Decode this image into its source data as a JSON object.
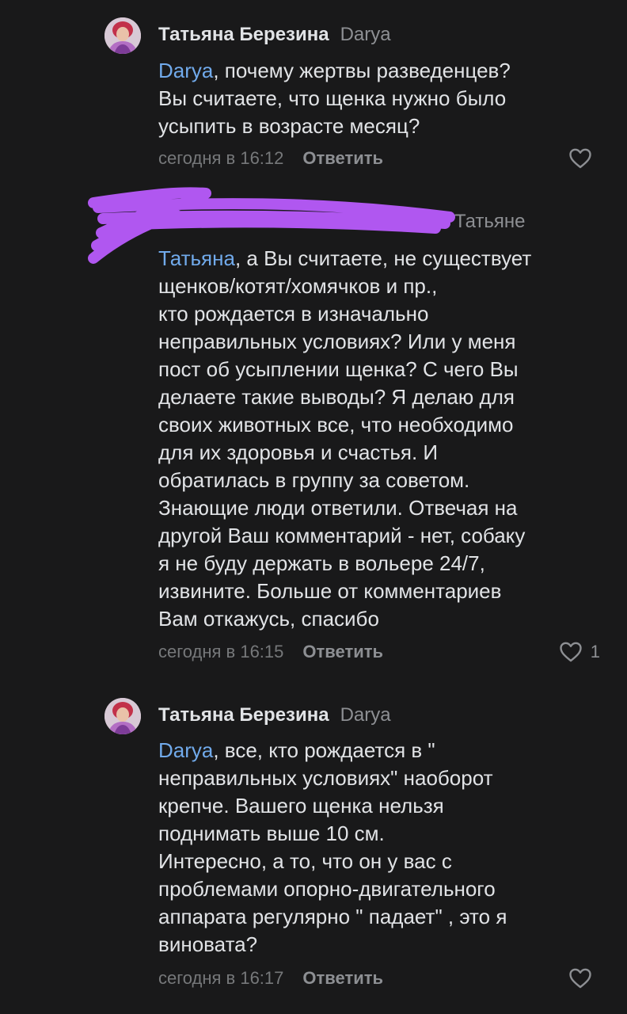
{
  "comments": [
    {
      "author": "Татьяна Березина",
      "reply_to": "Darya",
      "mention": "Darya",
      "text_lines": [
        ", почему жертвы разведенцев?",
        "Вы считаете, что щенка нужно было",
        "усыпить в возрасте месяц?"
      ],
      "time": "сегодня в 16:12",
      "reply_label": "Ответить",
      "likes": "",
      "avatar_icon": "user-photo"
    },
    {
      "author": "",
      "reply_to": "Татьяне",
      "mention": "Татьяна",
      "text_lines": [
        ", а Вы считаете, не существует",
        "щенков/котят/хомячков и пр.,",
        "кто рождается в изначально",
        "неправильных условиях? Или у меня",
        "пост об усыплении щенка? С чего Вы",
        "делаете такие выводы? Я делаю для",
        "своих животных все, что необходимо",
        "для их здоровья и счастья. И",
        "обратилась в группу за советом.",
        "Знающие люди ответили. Отвечая на",
        "другой Ваш комментарий - нет, собаку",
        "я не буду держать в вольере 24/7,",
        "извините. Больше от комментариев",
        "Вам откажусь, спасибо"
      ],
      "time": "сегодня в 16:15",
      "reply_label": "Ответить",
      "likes": "1",
      "redaction_color": "#b057f0"
    },
    {
      "author": "Татьяна Березина",
      "reply_to": "Darya",
      "mention": "Darya",
      "text_lines": [
        ", все, кто рождается в \"",
        "неправильных условиях\" наоборот",
        "крепче. Вашего щенка нельзя",
        "поднимать выше 10 см.",
        "Интересно, а то, что он у вас с",
        "проблемами опорно-двигательного",
        "аппарата регулярно \" падает\" , это я",
        "виновата?"
      ],
      "time": "сегодня в 16:17",
      "reply_label": "Ответить",
      "likes": "",
      "avatar_icon": "user-photo"
    }
  ],
  "colors": {
    "background": "#19191a",
    "text": "#e1e3e6",
    "mention": "#71aaeb",
    "secondary": "#8d8f93",
    "meta": "#76787a"
  },
  "icons": {
    "like": "heart-outline-icon"
  }
}
